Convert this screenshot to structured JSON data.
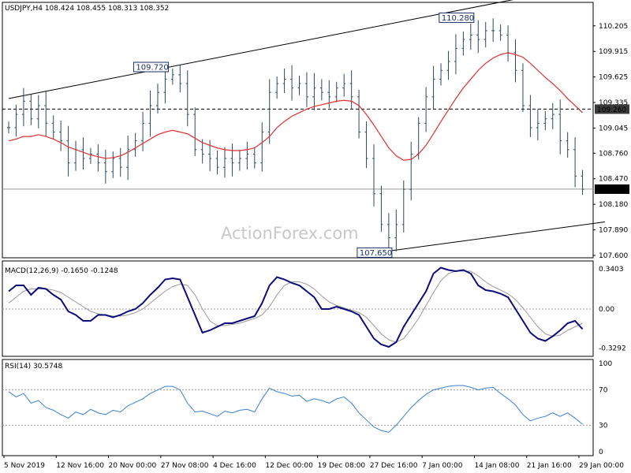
{
  "colors": {
    "price_bar": "#2a4b5d",
    "ma": "#e03030",
    "macd": "#0c0c7a",
    "signal": "#9a9a9a",
    "rsi": "#3a7fd6",
    "channel": "#000000",
    "frame": "#000000",
    "level_dash": "#000000",
    "current_line": "#9a9a9a",
    "watermark": "#c8c8c8"
  },
  "chart_data": [
    {
      "type": "candlestick",
      "panel": "price",
      "title": "USDJPY,H4  108.424 108.455 108.313 108.352",
      "symbol": "USDJPY",
      "timeframe": "H4",
      "ohlc_last": {
        "open": 108.424,
        "high": 108.455,
        "low": 108.313,
        "close": 108.352
      },
      "watermark": "ActionForex.com",
      "ylim": [
        107.6,
        110.4
      ],
      "y_ticks": [
        "110.205",
        "109.915",
        "109.625",
        "109.335",
        "109.045",
        "108.760",
        "108.470",
        "108.180",
        "107.890",
        "107.600"
      ],
      "x_ticks": [
        "5 Nov 2019",
        "12 Nov 16:00",
        "20 Nov 00:00",
        "27 Nov 08:00",
        "4 Dec 16:00",
        "12 Dec 00:00",
        "19 Dec 08:00",
        "27 Dec 16:00",
        "7 Jan 00:00",
        "14 Jan 08:00",
        "21 Jan 16:00",
        "29 Jan 00:00"
      ],
      "annotations": [
        {
          "text": "109.720",
          "bar_index": 21,
          "value": 109.72
        },
        {
          "text": "110.280",
          "bar_index": 62,
          "value": 110.28
        },
        {
          "text": "107.650",
          "bar_index": 51,
          "value": 107.65
        }
      ],
      "horizontal_levels": [
        {
          "value": 109.26,
          "label": "109.260",
          "style": "dashed"
        },
        {
          "value": 108.352,
          "label": "108.352",
          "style": "current"
        }
      ],
      "channel": {
        "upper": [
          {
            "bar_index": 0,
            "value": 109.38
          },
          {
            "bar_index": 76,
            "value": 110.64
          }
        ],
        "lower": [
          {
            "bar_index": 51,
            "value": 107.65
          },
          {
            "bar_index": 80,
            "value": 107.98
          }
        ]
      },
      "close": [
        109.05,
        109.2,
        109.35,
        109.15,
        109.3,
        109.1,
        109.0,
        108.9,
        108.65,
        108.8,
        108.7,
        108.75,
        108.65,
        108.55,
        108.7,
        108.6,
        108.8,
        108.9,
        109.1,
        109.3,
        109.45,
        109.6,
        109.65,
        109.55,
        109.2,
        108.8,
        108.75,
        108.7,
        108.6,
        108.7,
        108.65,
        108.7,
        108.75,
        108.65,
        109.0,
        109.45,
        109.55,
        109.6,
        109.5,
        109.55,
        109.4,
        109.5,
        109.45,
        109.4,
        109.5,
        109.55,
        109.4,
        109.0,
        108.7,
        108.3,
        107.95,
        107.8,
        107.95,
        108.35,
        108.75,
        109.1,
        109.4,
        109.6,
        109.7,
        109.8,
        109.95,
        110.05,
        110.1,
        110.05,
        110.15,
        110.15,
        110.1,
        109.9,
        109.7,
        109.3,
        109.05,
        109.1,
        109.15,
        109.2,
        108.9,
        108.8,
        108.5,
        108.35
      ],
      "ma": [
        108.9,
        108.92,
        108.95,
        108.95,
        108.97,
        108.95,
        108.92,
        108.88,
        108.83,
        108.8,
        108.77,
        108.74,
        108.72,
        108.7,
        108.71,
        108.73,
        108.77,
        108.82,
        108.87,
        108.92,
        108.97,
        109.0,
        109.02,
        109.0,
        108.98,
        108.93,
        108.88,
        108.85,
        108.82,
        108.8,
        108.79,
        108.79,
        108.8,
        108.82,
        108.88,
        108.95,
        109.05,
        109.12,
        109.18,
        109.22,
        109.26,
        109.29,
        109.31,
        109.33,
        109.35,
        109.36,
        109.35,
        109.3,
        109.2,
        109.08,
        108.95,
        108.82,
        108.73,
        108.68,
        108.69,
        108.75,
        108.85,
        108.98,
        109.12,
        109.25,
        109.38,
        109.5,
        109.6,
        109.7,
        109.78,
        109.84,
        109.88,
        109.9,
        109.88,
        109.85,
        109.78,
        109.7,
        109.62,
        109.55,
        109.47,
        109.38,
        109.3,
        109.22
      ]
    },
    {
      "type": "line",
      "panel": "macd",
      "title": "MACD(12,26,9) -0.1650 -0.1248",
      "ylim": [
        -0.38,
        0.38
      ],
      "y_ticks": [
        "0.3403",
        "0.00",
        "-0.3292"
      ],
      "series": [
        {
          "values": [
            0.15,
            0.2,
            0.2,
            0.12,
            0.18,
            0.17,
            0.12,
            0.08,
            -0.02,
            -0.05,
            -0.1,
            -0.1,
            -0.05,
            -0.05,
            -0.07,
            -0.05,
            -0.02,
            0.0,
            0.05,
            0.12,
            0.18,
            0.25,
            0.26,
            0.25,
            0.1,
            -0.05,
            -0.2,
            -0.18,
            -0.15,
            -0.12,
            -0.12,
            -0.1,
            -0.08,
            -0.06,
            0.05,
            0.2,
            0.27,
            0.25,
            0.22,
            0.2,
            0.15,
            0.1,
            0.0,
            0.0,
            0.02,
            0.0,
            -0.02,
            -0.05,
            -0.15,
            -0.25,
            -0.3,
            -0.32,
            -0.28,
            -0.15,
            -0.05,
            0.05,
            0.15,
            0.3,
            0.35,
            0.33,
            0.32,
            0.33,
            0.3,
            0.2,
            0.16,
            0.15,
            0.13,
            0.1,
            0.0,
            -0.1,
            -0.2,
            -0.25,
            -0.27,
            -0.23,
            -0.18,
            -0.12,
            -0.1,
            -0.17
          ]
        },
        {
          "values": [
            0.05,
            0.1,
            0.15,
            0.17,
            0.17,
            0.17,
            0.16,
            0.14,
            0.1,
            0.06,
            0.02,
            -0.02,
            -0.04,
            -0.05,
            -0.06,
            -0.06,
            -0.05,
            -0.03,
            0.0,
            0.05,
            0.1,
            0.15,
            0.19,
            0.21,
            0.2,
            0.12,
            0.0,
            -0.1,
            -0.14,
            -0.14,
            -0.13,
            -0.12,
            -0.1,
            -0.08,
            -0.05,
            0.02,
            0.12,
            0.2,
            0.23,
            0.23,
            0.21,
            0.17,
            0.11,
            0.06,
            0.03,
            0.01,
            -0.01,
            -0.03,
            -0.07,
            -0.14,
            -0.21,
            -0.26,
            -0.28,
            -0.25,
            -0.17,
            -0.08,
            0.03,
            0.14,
            0.24,
            0.3,
            0.32,
            0.32,
            0.32,
            0.28,
            0.23,
            0.19,
            0.16,
            0.13,
            0.08,
            0.01,
            -0.07,
            -0.15,
            -0.21,
            -0.23,
            -0.22,
            -0.18,
            -0.15,
            -0.12
          ]
        }
      ]
    },
    {
      "type": "line",
      "panel": "rsi",
      "title": "RSI(14) 30.5748",
      "ylim": [
        0,
        100
      ],
      "y_ticks": [
        "100",
        "70",
        "30",
        "0"
      ],
      "levels": [
        70,
        30
      ],
      "series": [
        {
          "values": [
            68,
            62,
            66,
            55,
            58,
            50,
            47,
            42,
            38,
            45,
            42,
            48,
            44,
            42,
            47,
            45,
            52,
            56,
            60,
            66,
            70,
            74,
            74,
            70,
            55,
            45,
            46,
            43,
            40,
            46,
            44,
            47,
            48,
            45,
            60,
            72,
            68,
            66,
            63,
            64,
            57,
            60,
            58,
            55,
            60,
            62,
            55,
            44,
            36,
            28,
            24,
            22,
            30,
            40,
            50,
            58,
            65,
            70,
            72,
            74,
            75,
            75,
            73,
            70,
            72,
            73,
            66,
            60,
            53,
            42,
            35,
            38,
            40,
            44,
            40,
            44,
            38,
            31
          ]
        }
      ]
    }
  ]
}
